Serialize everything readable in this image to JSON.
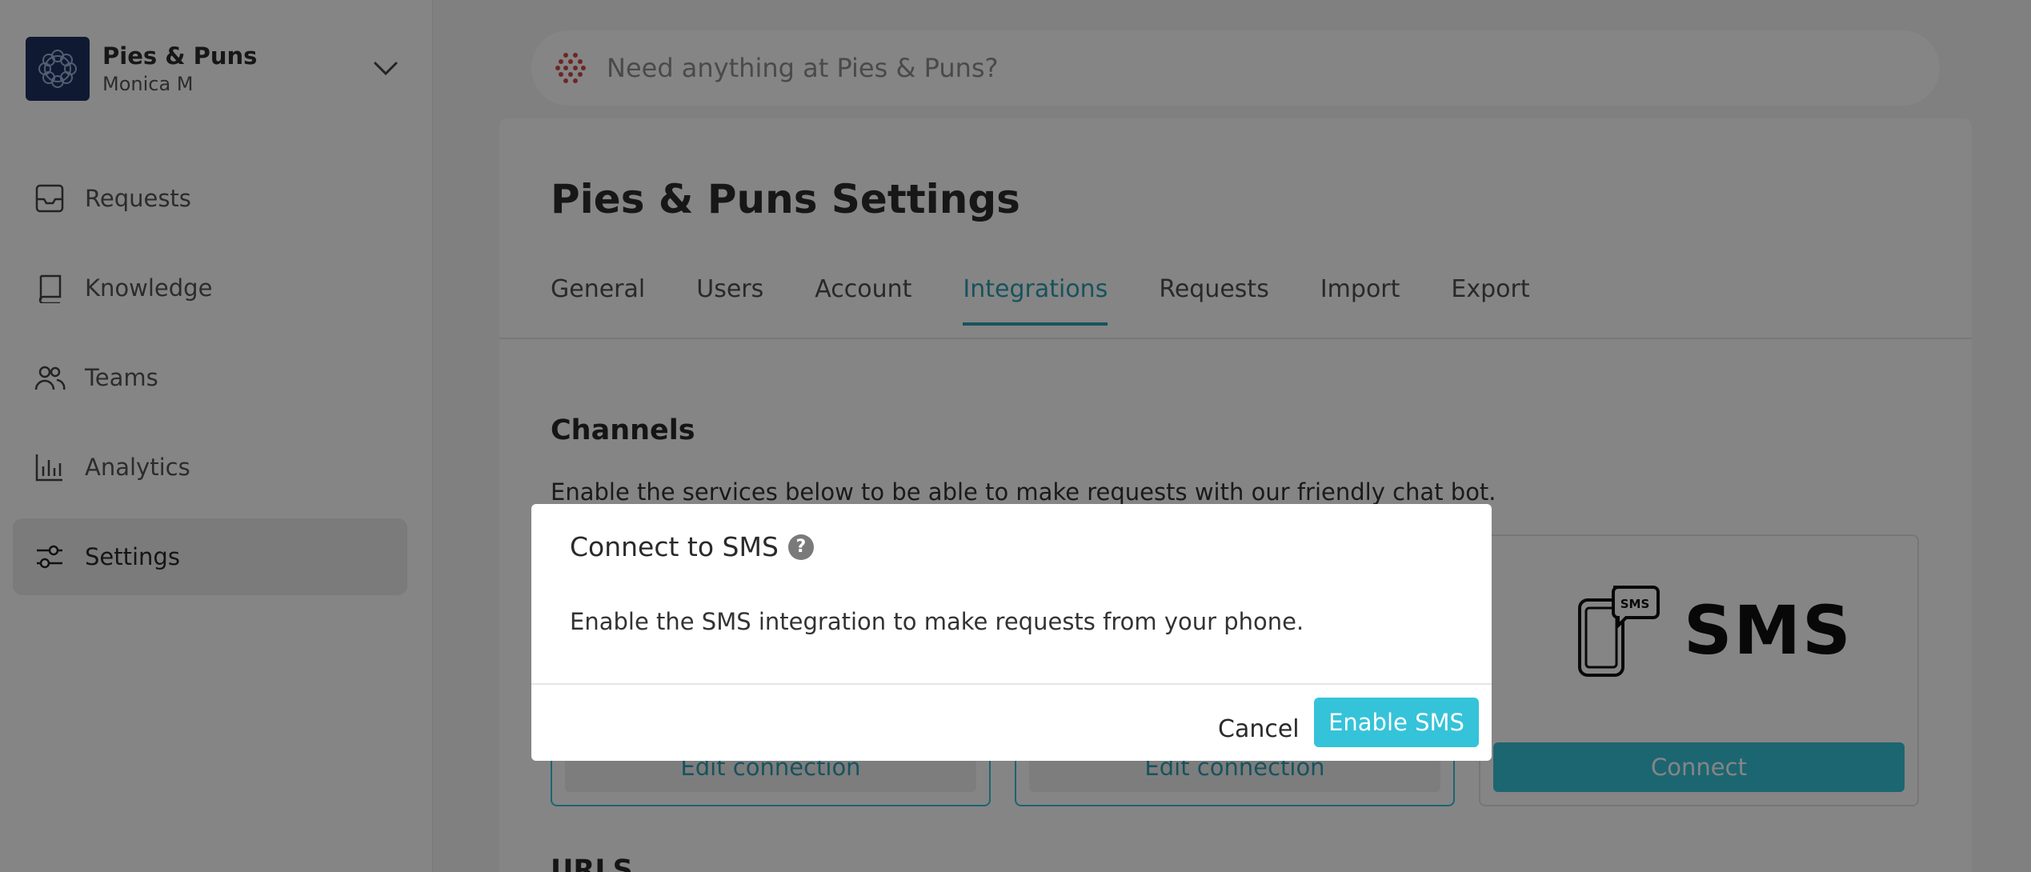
{
  "org": {
    "name": "Pies & Puns",
    "user": "Monica M"
  },
  "search": {
    "placeholder": "Need anything at Pies & Puns?"
  },
  "sidebar": {
    "items": [
      {
        "label": "Requests",
        "icon": "inbox-icon"
      },
      {
        "label": "Knowledge",
        "icon": "book-icon"
      },
      {
        "label": "Teams",
        "icon": "users-icon"
      },
      {
        "label": "Analytics",
        "icon": "bar-chart-icon"
      },
      {
        "label": "Settings",
        "icon": "sliders-icon",
        "active": true
      }
    ]
  },
  "page": {
    "title_org": "Pies & Puns",
    "title_rest": "Settings",
    "tabs": [
      "General",
      "Users",
      "Account",
      "Integrations",
      "Requests",
      "Import",
      "Export"
    ],
    "active_tab": "Integrations"
  },
  "channels": {
    "title": "Channels",
    "description": "Enable the services below to be able to make requests with our friendly chat bot.",
    "cards": [
      {
        "button": "Edit connection"
      },
      {
        "button": "Edit connection"
      },
      {
        "logo_text": "SMS",
        "logo_badge": "SMS",
        "button": "Connect"
      }
    ]
  },
  "next_section": {
    "title": "URLS"
  },
  "modal": {
    "title": "Connect to SMS",
    "help": "?",
    "body": "Enable the SMS integration to make requests from your phone.",
    "cancel": "Cancel",
    "confirm": "Enable SMS"
  },
  "colors": {
    "accent": "#35c3d9",
    "link": "#2d9fb3",
    "brand_logo": "#1d3260",
    "search_icon": "#d24a4a"
  }
}
